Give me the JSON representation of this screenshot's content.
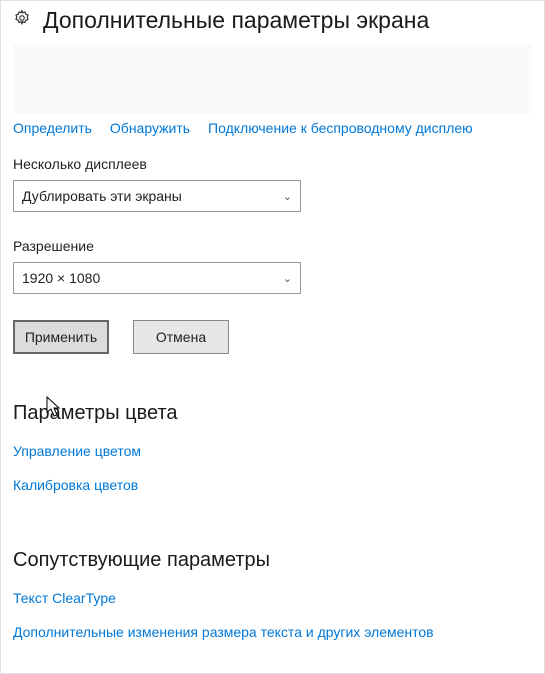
{
  "header": {
    "title": "Дополнительные параметры экрана"
  },
  "links": {
    "identify": "Определить",
    "detect": "Обнаружить",
    "wireless": "Подключение к беспроводному дисплею"
  },
  "multipleDisplays": {
    "label": "Несколько дисплеев",
    "value": "Дублировать эти экраны"
  },
  "resolution": {
    "label": "Разрешение",
    "value": "1920 × 1080"
  },
  "buttons": {
    "apply": "Применить",
    "cancel": "Отмена"
  },
  "colorSection": {
    "heading": "Параметры цвета",
    "manage": "Управление цветом",
    "calibrate": "Калибровка цветов"
  },
  "relatedSection": {
    "heading": "Сопутствующие параметры",
    "cleartype": "Текст ClearType",
    "advancedSizing": "Дополнительные изменения размера текста и других элементов"
  }
}
